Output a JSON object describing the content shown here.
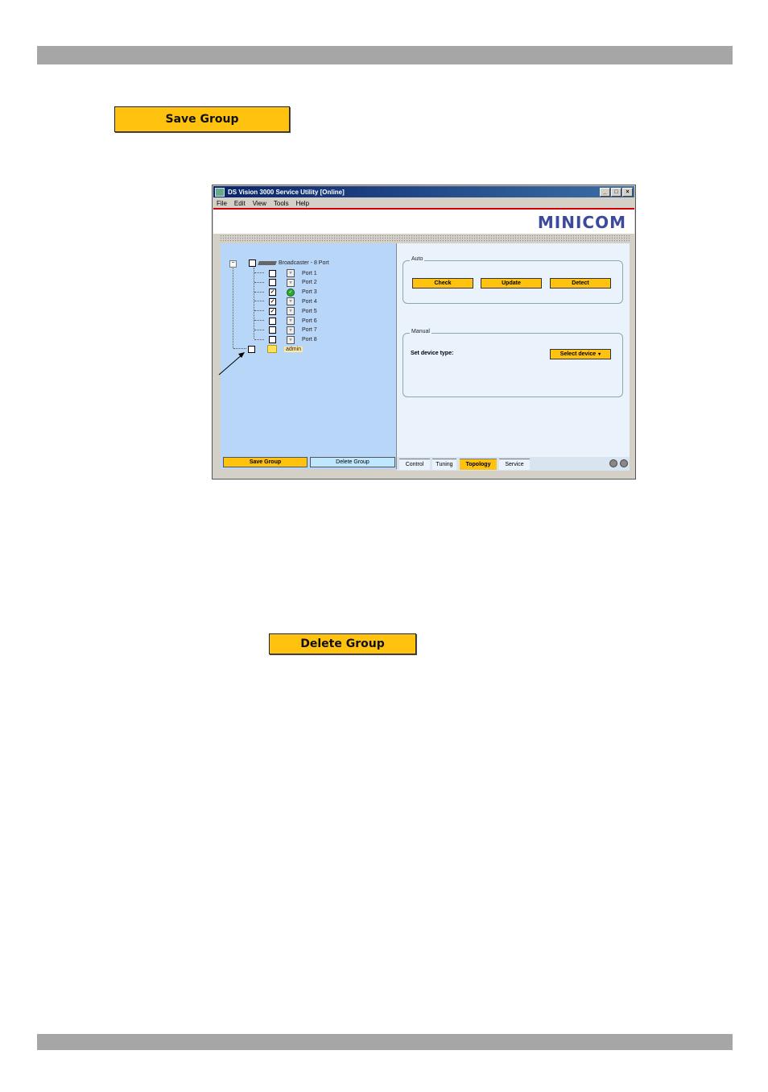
{
  "page": {
    "save_group_button": "Save Group",
    "delete_group_button": "Delete Group"
  },
  "window": {
    "title": "DS Vision 3000 Service Utility [Online]",
    "controls": [
      "_",
      "□",
      "×"
    ],
    "menu": [
      "File",
      "Edit",
      "View",
      "Tools",
      "Help"
    ],
    "logo": "MINICOM",
    "tree": {
      "root_label": "Broadcaster - 8 Port",
      "ports": [
        {
          "label": "Port 1",
          "checked": false,
          "status": "default"
        },
        {
          "label": "Port 2",
          "checked": false,
          "status": "default"
        },
        {
          "label": "Port 3",
          "checked": true,
          "status": "ok"
        },
        {
          "label": "Port 4",
          "checked": true,
          "status": "default"
        },
        {
          "label": "Port 5",
          "checked": true,
          "status": "default"
        },
        {
          "label": "Port 6",
          "checked": false,
          "status": "default"
        },
        {
          "label": "Port 7",
          "checked": false,
          "status": "default"
        },
        {
          "label": "Port 8",
          "checked": false,
          "status": "default"
        }
      ],
      "group_label": "admin"
    },
    "auto": {
      "legend": "Auto",
      "check": "Check",
      "update": "Update",
      "detect": "Detect"
    },
    "manual": {
      "legend": "Manual",
      "set_device_label": "Set device type:",
      "select_device": "Select device"
    },
    "left_buttons": {
      "save": "Save Group",
      "delete": "Delete Group"
    },
    "tabs": [
      {
        "label": "Control",
        "active": false
      },
      {
        "label": "Tuning",
        "active": false
      },
      {
        "label": "Topology",
        "active": true
      },
      {
        "label": "Service",
        "active": false
      }
    ],
    "colors": {
      "accent": "#ffc20e",
      "left_pane": "#b8d6f8",
      "right_pane": "#eaf3fc"
    }
  }
}
